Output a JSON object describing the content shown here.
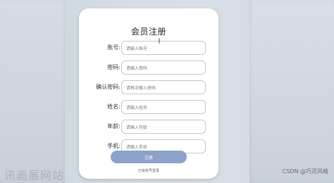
{
  "page": {
    "watermark_left": "讯画展网站",
    "watermark_right": "CSDN @巧灵风格"
  },
  "form": {
    "title": "会员注册",
    "fields": [
      {
        "label": "账号:",
        "placeholder": "请输入账号"
      },
      {
        "label": "密码:",
        "placeholder": "请输入密码"
      },
      {
        "label": "确认密码:",
        "placeholder": "请再次输入密码"
      },
      {
        "label": "姓名:",
        "placeholder": "请输入姓名"
      },
      {
        "label": "年龄:",
        "placeholder": "请输入年龄"
      },
      {
        "label": "手机:",
        "placeholder": "请输入手机"
      }
    ],
    "submit_label": "注册",
    "login_link": "已有账号登录"
  },
  "icons": {
    "text_cursor": "text-cursor-icon"
  },
  "colors": {
    "accent": "#8ca2c8",
    "card_bg": "#ffffff"
  }
}
